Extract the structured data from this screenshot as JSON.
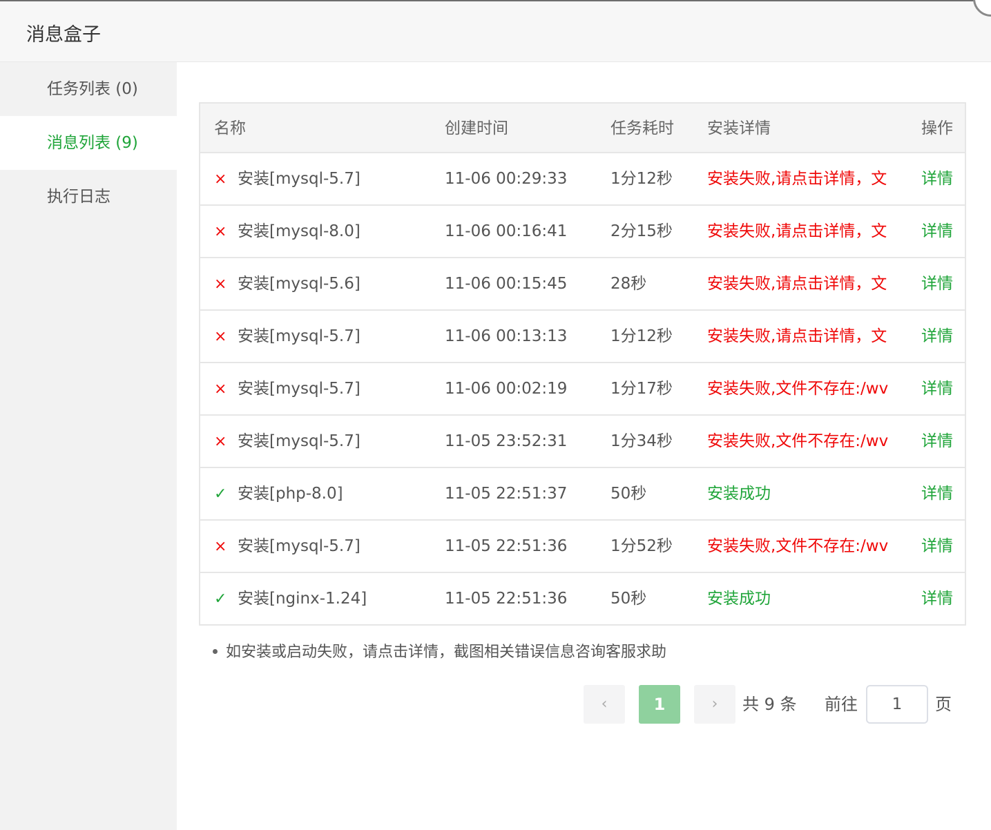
{
  "dialog": {
    "title": "消息盒子"
  },
  "sidebar": {
    "items": [
      {
        "label": "任务列表 (0)",
        "active": false
      },
      {
        "label": "消息列表 (9)",
        "active": true
      },
      {
        "label": "执行日志",
        "active": false
      }
    ]
  },
  "table": {
    "columns": [
      "名称",
      "创建时间",
      "任务耗时",
      "安装详情",
      "操作"
    ],
    "rows": [
      {
        "status": "fail",
        "name": "安装[mysql-5.7]",
        "time": "11-06 00:29:33",
        "cost": "1分12秒",
        "detail": "安装失败,请点击详情，文",
        "op": "详情"
      },
      {
        "status": "fail",
        "name": "安装[mysql-8.0]",
        "time": "11-06 00:16:41",
        "cost": "2分15秒",
        "detail": "安装失败,请点击详情，文",
        "op": "详情"
      },
      {
        "status": "fail",
        "name": "安装[mysql-5.6]",
        "time": "11-06 00:15:45",
        "cost": "28秒",
        "detail": "安装失败,请点击详情，文",
        "op": "详情"
      },
      {
        "status": "fail",
        "name": "安装[mysql-5.7]",
        "time": "11-06 00:13:13",
        "cost": "1分12秒",
        "detail": "安装失败,请点击详情，文",
        "op": "详情"
      },
      {
        "status": "fail",
        "name": "安装[mysql-5.7]",
        "time": "11-06 00:02:19",
        "cost": "1分17秒",
        "detail": "安装失败,文件不存在:/wv",
        "op": "详情"
      },
      {
        "status": "fail",
        "name": "安装[mysql-5.7]",
        "time": "11-05 23:52:31",
        "cost": "1分34秒",
        "detail": "安装失败,文件不存在:/wv",
        "op": "详情"
      },
      {
        "status": "ok",
        "name": "安装[php-8.0]",
        "time": "11-05 22:51:37",
        "cost": "50秒",
        "detail": "安装成功",
        "op": "详情"
      },
      {
        "status": "fail",
        "name": "安装[mysql-5.7]",
        "time": "11-05 22:51:36",
        "cost": "1分52秒",
        "detail": "安装失败,文件不存在:/wv",
        "op": "详情"
      },
      {
        "status": "ok",
        "name": "安装[nginx-1.24]",
        "time": "11-05 22:51:36",
        "cost": "50秒",
        "detail": "安装成功",
        "op": "详情"
      }
    ]
  },
  "icons": {
    "fail": "×",
    "ok": "✓"
  },
  "tip": "如安装或启动失败，请点击详情，截图相关错误信息咨询客服求助",
  "pagination": {
    "prev_icon": "‹",
    "next_icon": "›",
    "current_page": "1",
    "total_text": "共 9 条",
    "goto_label": "前往",
    "goto_value": "1",
    "page_suffix": "页"
  },
  "colors": {
    "accent": "#20a53a",
    "fail": "#ef0808",
    "active_page": "#8fd19e"
  }
}
